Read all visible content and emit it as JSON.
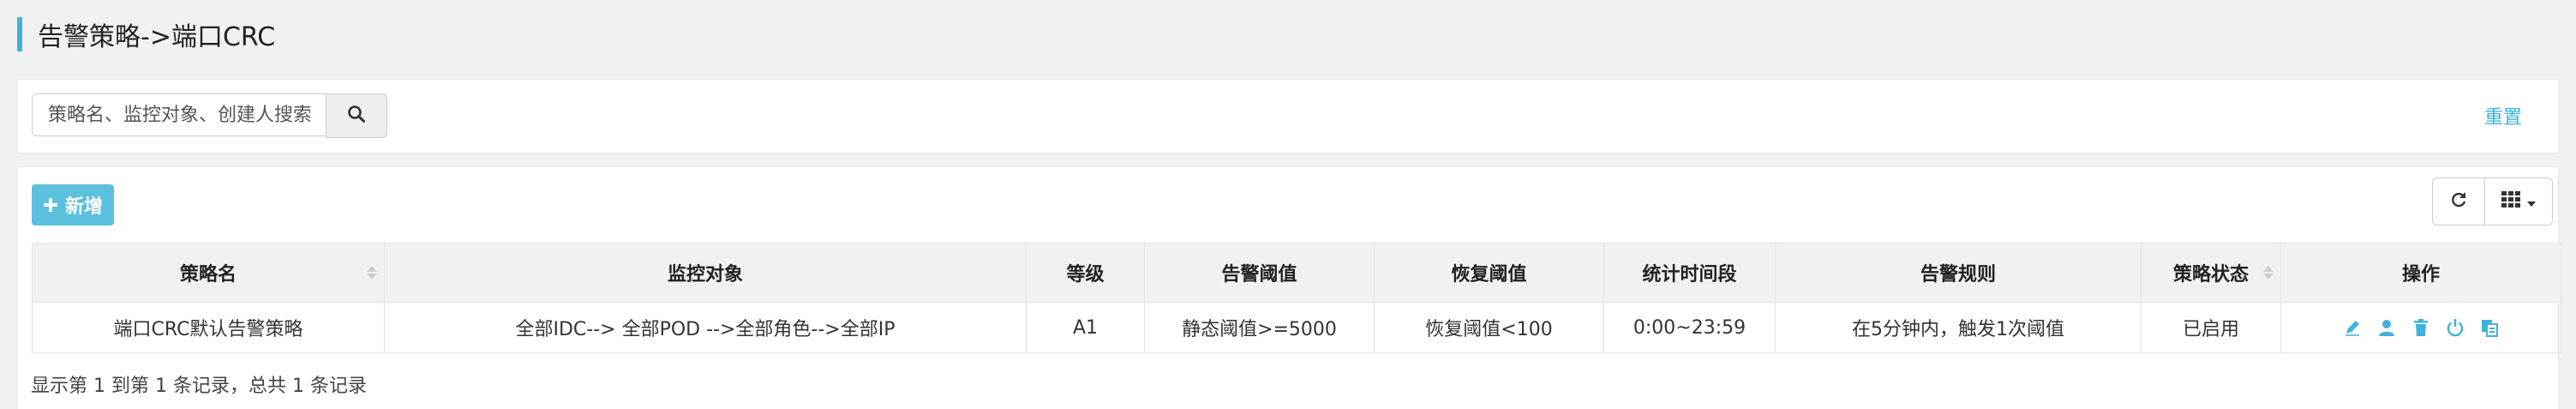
{
  "page": {
    "title": "告警策略->端口CRC"
  },
  "search": {
    "placeholder": "策略名、监控对象、创建人搜索",
    "reset_label": "重置"
  },
  "toolbar": {
    "add_label": "新增"
  },
  "table": {
    "columns": [
      "策略名",
      "监控对象",
      "等级",
      "告警阈值",
      "恢复阈值",
      "统计时间段",
      "告警规则",
      "策略状态",
      "操作"
    ],
    "rows": [
      {
        "name": "端口CRC默认告警策略",
        "target": "全部IDC--> 全部POD -->全部角色-->全部IP",
        "level": "A1",
        "alarm_threshold": "静态阈值>=5000",
        "recover_threshold": "恢复阈值<100",
        "time_range": "0:00~23:59",
        "rule": "在5分钟内，触发1次阈值",
        "status": "已启用"
      }
    ]
  },
  "footer": {
    "summary": "显示第 1 到第 1 条记录，总共 1 条记录"
  },
  "colors": {
    "accent": "#3fb3d9",
    "add_button": "#5bc0de",
    "level_red": "#e02020",
    "status_green": "#2eaa2e"
  },
  "icons": [
    "search-icon",
    "plus-icon",
    "refresh-icon",
    "columns-icon",
    "caret-down-icon",
    "edit-icon",
    "user-icon",
    "trash-icon",
    "power-icon",
    "copy-icon"
  ]
}
